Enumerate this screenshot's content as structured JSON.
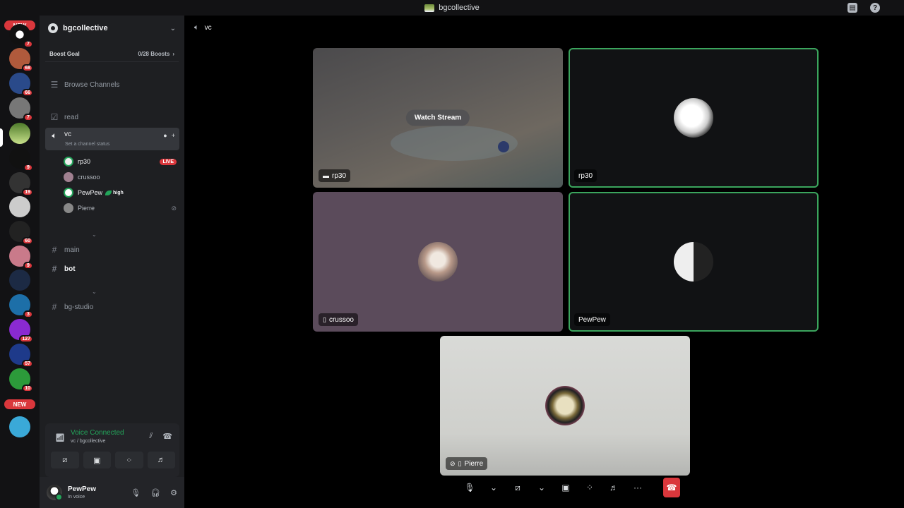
{
  "window": {
    "title": "bgcollective"
  },
  "rail": {
    "new_label_top": "NEW",
    "new_label_bottom": "NEW",
    "badges": [
      "7",
      "68",
      "66",
      "7",
      "9",
      "19",
      "60",
      "9",
      "3",
      "127",
      "57",
      "10"
    ]
  },
  "sidebar": {
    "server_name": "bgcollective",
    "boost_goal": "Boost Goal",
    "boost_count": "0/28 Boosts",
    "browse_channels": "Browse Channels",
    "channels": {
      "read": "read",
      "vc": "vc",
      "vc_status": "Set a channel status",
      "main": "main",
      "bot": "bot",
      "bg_studio": "bg-studio"
    },
    "voice_members": [
      {
        "name": "rp30",
        "tag": "LIVE"
      },
      {
        "name": "crussoo"
      },
      {
        "name": "PewPew",
        "tag": "high"
      },
      {
        "name": "Pierre"
      }
    ]
  },
  "voice_panel": {
    "status": "Voice Connected",
    "location": "vc / bgcollective"
  },
  "user": {
    "name": "PewPew",
    "status": "In voice"
  },
  "stage": {
    "channel": "vc",
    "watch_stream": "Watch Stream",
    "tiles": [
      {
        "name": "rp30"
      },
      {
        "name": "rp30"
      },
      {
        "name": "crussoo"
      },
      {
        "name": "PewPew"
      },
      {
        "name": "Pierre"
      }
    ]
  },
  "colors": {
    "speaking_border": "#3ba55d",
    "hangup": "#da373c",
    "voice_connected": "#23a55a"
  }
}
